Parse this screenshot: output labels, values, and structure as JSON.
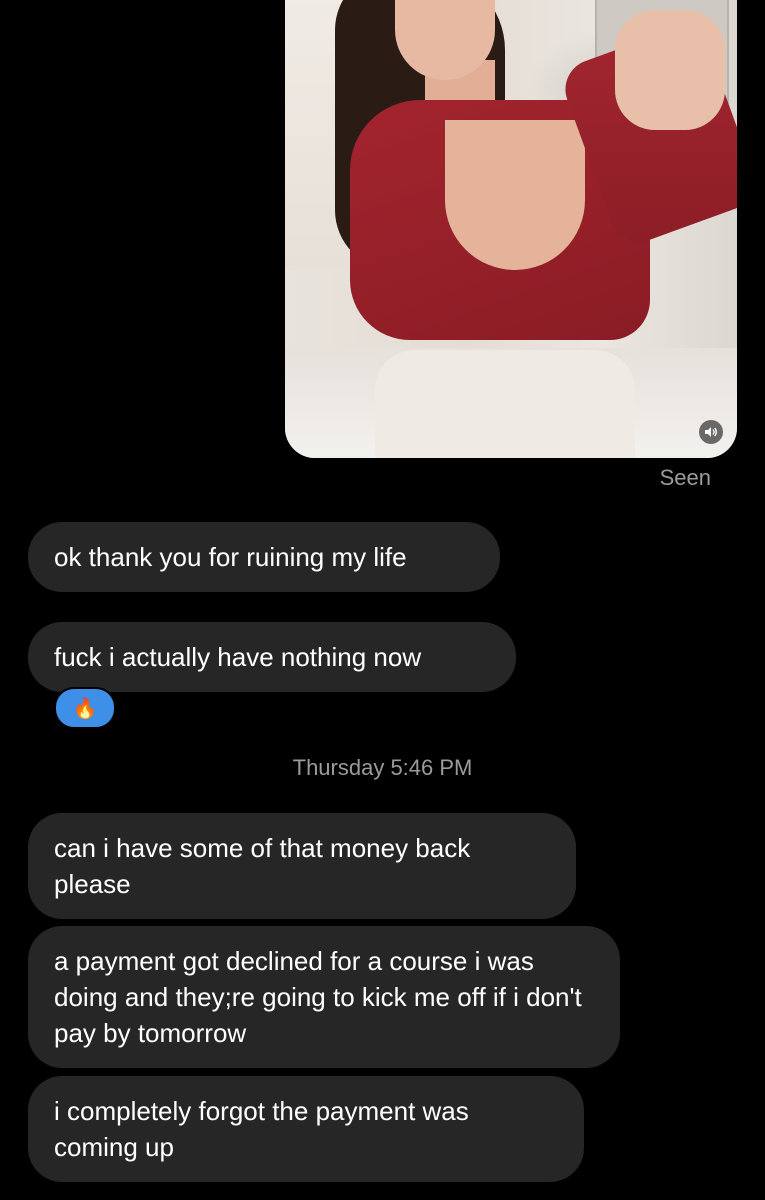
{
  "sent_photo": {
    "status": "Seen",
    "sound_icon": "speaker-icon"
  },
  "reaction": {
    "emoji": "🔥"
  },
  "timestamp": "Thursday 5:46 PM",
  "messages": [
    {
      "text": "ok thank you for ruining my life"
    },
    {
      "text": "fuck i actually have nothing now"
    },
    {
      "text": "can i have some of that money back please"
    },
    {
      "text": "a payment got declined for a course i was doing and they;re going to kick me off if i don't pay by tomorrow"
    },
    {
      "text": "i completely forgot the payment was coming up"
    }
  ]
}
